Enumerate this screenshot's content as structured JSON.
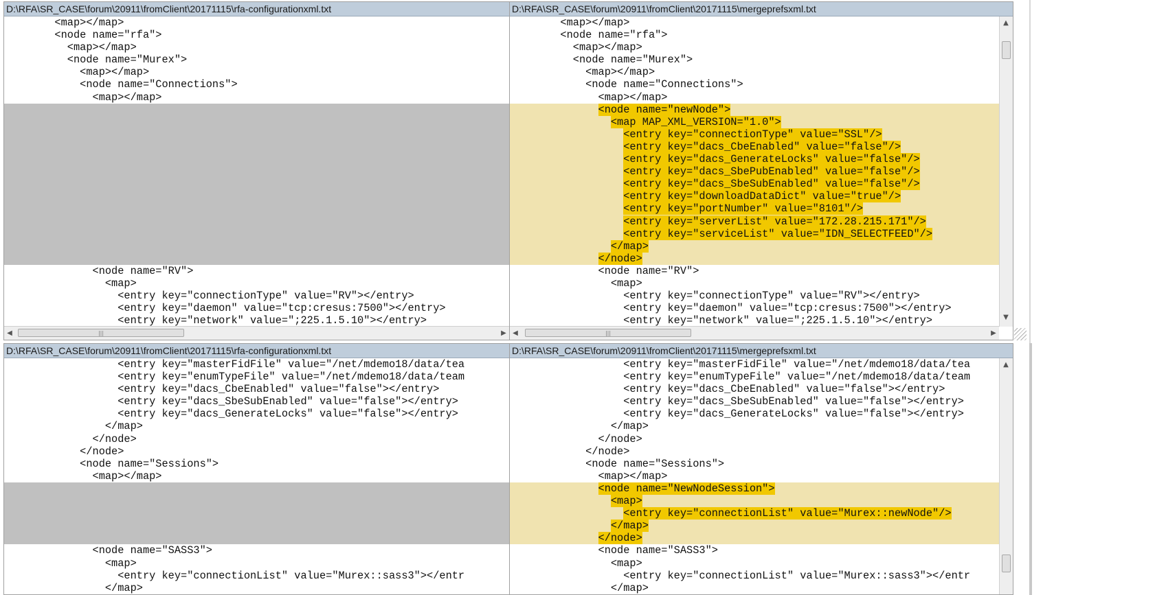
{
  "panes": {
    "top_left": {
      "title": "D:\\RFA\\SR_CASE\\forum\\20911\\fromClient\\20171115\\rfa-configurationxml.txt",
      "lines": [
        {
          "t": "        <map></map>"
        },
        {
          "t": "        <node name=\"rfa\">"
        },
        {
          "t": "          <map></map>"
        },
        {
          "t": "          <node name=\"Murex\">"
        },
        {
          "t": "            <map></map>"
        },
        {
          "t": "            <node name=\"Connections\">"
        },
        {
          "t": "              <map></map>"
        },
        {
          "t": "",
          "k": "blank"
        },
        {
          "t": "",
          "k": "blank"
        },
        {
          "t": "",
          "k": "blank"
        },
        {
          "t": "",
          "k": "blank"
        },
        {
          "t": "",
          "k": "blank"
        },
        {
          "t": "",
          "k": "blank"
        },
        {
          "t": "",
          "k": "blank"
        },
        {
          "t": "",
          "k": "blank"
        },
        {
          "t": "",
          "k": "blank"
        },
        {
          "t": "",
          "k": "blank"
        },
        {
          "t": "",
          "k": "blank"
        },
        {
          "t": "",
          "k": "blank"
        },
        {
          "t": "",
          "k": "blank"
        },
        {
          "t": "              <node name=\"RV\">"
        },
        {
          "t": "                <map>"
        },
        {
          "t": "                  <entry key=\"connectionType\" value=\"RV\"></entry>"
        },
        {
          "t": "                  <entry key=\"daemon\" value=\"tcp:cresus:7500\"></entry>"
        },
        {
          "t": "                  <entry key=\"network\" value=\";225.1.5.10\"></entry>"
        }
      ]
    },
    "top_right": {
      "title": "D:\\RFA\\SR_CASE\\forum\\20911\\fromClient\\20171115\\mergeprefsxml.txt",
      "lines": [
        {
          "t": "        <map></map>"
        },
        {
          "t": "        <node name=\"rfa\">"
        },
        {
          "t": "          <map></map>"
        },
        {
          "t": "          <node name=\"Murex\">"
        },
        {
          "t": "            <map></map>"
        },
        {
          "t": "            <node name=\"Connections\">"
        },
        {
          "t": "              <map></map>"
        },
        {
          "t": "              <node name=\"newNode\">",
          "k": "hl",
          "i": 14
        },
        {
          "t": "                <map MAP_XML_VERSION=\"1.0\">",
          "k": "hl",
          "i": 16
        },
        {
          "t": "                  <entry key=\"connectionType\" value=\"SSL\"/>",
          "k": "hl",
          "i": 18
        },
        {
          "t": "                  <entry key=\"dacs_CbeEnabled\" value=\"false\"/>",
          "k": "hl",
          "i": 18
        },
        {
          "t": "                  <entry key=\"dacs_GenerateLocks\" value=\"false\"/>",
          "k": "hl",
          "i": 18
        },
        {
          "t": "                  <entry key=\"dacs_SbePubEnabled\" value=\"false\"/>",
          "k": "hl",
          "i": 18
        },
        {
          "t": "                  <entry key=\"dacs_SbeSubEnabled\" value=\"false\"/>",
          "k": "hl",
          "i": 18
        },
        {
          "t": "                  <entry key=\"downloadDataDict\" value=\"true\"/>",
          "k": "hl",
          "i": 18
        },
        {
          "t": "                  <entry key=\"portNumber\" value=\"8101\"/>",
          "k": "hl",
          "i": 18
        },
        {
          "t": "                  <entry key=\"serverList\" value=\"172.28.215.171\"/>",
          "k": "hl",
          "i": 18
        },
        {
          "t": "                  <entry key=\"serviceList\" value=\"IDN_SELECTFEED\"/>",
          "k": "hl",
          "i": 18
        },
        {
          "t": "                </map>",
          "k": "hl",
          "i": 16
        },
        {
          "t": "              </node>",
          "k": "hl",
          "i": 14
        },
        {
          "t": "              <node name=\"RV\">"
        },
        {
          "t": "                <map>"
        },
        {
          "t": "                  <entry key=\"connectionType\" value=\"RV\"></entry>"
        },
        {
          "t": "                  <entry key=\"daemon\" value=\"tcp:cresus:7500\"></entry>"
        },
        {
          "t": "                  <entry key=\"network\" value=\";225.1.5.10\"></entry>"
        }
      ]
    },
    "bottom_left": {
      "title": "D:\\RFA\\SR_CASE\\forum\\20911\\fromClient\\20171115\\rfa-configurationxml.txt",
      "lines": [
        {
          "t": "                  <entry key=\"masterFidFile\" value=\"/net/mdemo18/data/tea"
        },
        {
          "t": "                  <entry key=\"enumTypeFile\" value=\"/net/mdemo18/data/team"
        },
        {
          "t": "                  <entry key=\"dacs_CbeEnabled\" value=\"false\"></entry>"
        },
        {
          "t": "                  <entry key=\"dacs_SbeSubEnabled\" value=\"false\"></entry>"
        },
        {
          "t": "                  <entry key=\"dacs_GenerateLocks\" value=\"false\"></entry>"
        },
        {
          "t": "                </map>"
        },
        {
          "t": "              </node>"
        },
        {
          "t": "            </node>"
        },
        {
          "t": "            <node name=\"Sessions\">"
        },
        {
          "t": "              <map></map>"
        },
        {
          "t": "",
          "k": "blank"
        },
        {
          "t": "",
          "k": "blank"
        },
        {
          "t": "",
          "k": "blank"
        },
        {
          "t": "",
          "k": "blank"
        },
        {
          "t": "",
          "k": "blank"
        },
        {
          "t": "              <node name=\"SASS3\">"
        },
        {
          "t": "                <map>"
        },
        {
          "t": "                  <entry key=\"connectionList\" value=\"Murex::sass3\"></entr"
        },
        {
          "t": "                </map>"
        }
      ]
    },
    "bottom_right": {
      "title": "D:\\RFA\\SR_CASE\\forum\\20911\\fromClient\\20171115\\mergeprefsxml.txt",
      "lines": [
        {
          "t": "                  <entry key=\"masterFidFile\" value=\"/net/mdemo18/data/tea"
        },
        {
          "t": "                  <entry key=\"enumTypeFile\" value=\"/net/mdemo18/data/team"
        },
        {
          "t": "                  <entry key=\"dacs_CbeEnabled\" value=\"false\"></entry>"
        },
        {
          "t": "                  <entry key=\"dacs_SbeSubEnabled\" value=\"false\"></entry>"
        },
        {
          "t": "                  <entry key=\"dacs_GenerateLocks\" value=\"false\"></entry>"
        },
        {
          "t": "                </map>"
        },
        {
          "t": "              </node>"
        },
        {
          "t": "            </node>"
        },
        {
          "t": "            <node name=\"Sessions\">"
        },
        {
          "t": "              <map></map>"
        },
        {
          "t": "              <node name=\"NewNodeSession\">",
          "k": "hl",
          "i": 14
        },
        {
          "t": "                <map>",
          "k": "hl",
          "i": 16
        },
        {
          "t": "                  <entry key=\"connectionList\" value=\"Murex::newNode\"/>",
          "k": "hl",
          "i": 18
        },
        {
          "t": "                </map>",
          "k": "hl",
          "i": 16
        },
        {
          "t": "              </node>",
          "k": "hl",
          "i": 14
        },
        {
          "t": "              <node name=\"SASS3\">"
        },
        {
          "t": "                <map>"
        },
        {
          "t": "                  <entry key=\"connectionList\" value=\"Murex::sass3\"></entr"
        },
        {
          "t": "                </map>"
        }
      ]
    }
  },
  "scrollbar": {
    "left_arrow": "◀",
    "right_arrow": "▶",
    "up_arrow": "▲",
    "down_arrow": "▼",
    "grip": "|||"
  },
  "colors": {
    "inserted_text_bg": "#f1c800",
    "inserted_line_bg": "#f0e3b0",
    "missing_line_bg": "#c0c0c0",
    "title_bar_bg": "#bfcddb"
  }
}
